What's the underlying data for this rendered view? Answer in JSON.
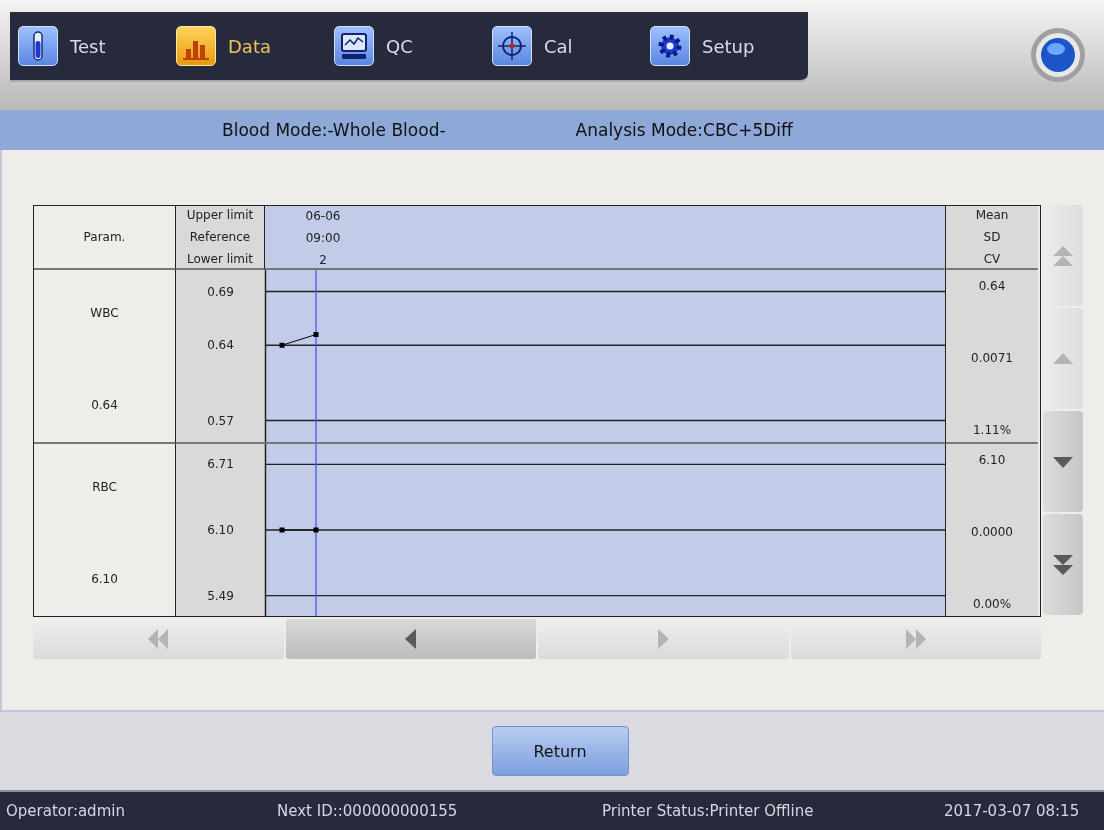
{
  "tabs": [
    {
      "label": "Test",
      "kind": "tube",
      "selected": false
    },
    {
      "label": "Data",
      "kind": "bars",
      "selected": true
    },
    {
      "label": "QC",
      "kind": "monitor",
      "selected": false
    },
    {
      "label": "Cal",
      "kind": "crosshair",
      "selected": false
    },
    {
      "label": "Setup",
      "kind": "gear",
      "selected": false
    }
  ],
  "mode_bar": {
    "blood_mode": "Blood Mode:-Whole Blood-",
    "analysis_mode": "Analysis Mode:CBC+5Diff"
  },
  "table": {
    "param_header": "Param.",
    "limit_headers": [
      "Upper limit",
      "Reference",
      "Lower limit"
    ],
    "point_header": [
      "06-06",
      "09:00",
      "2"
    ],
    "stat_headers": [
      "Mean",
      "SD",
      "CV"
    ],
    "rows": [
      {
        "param": "WBC",
        "value": "0.64",
        "stats": [
          "0.64",
          "0.0071",
          "1.11%"
        ],
        "chart_data": {
          "type": "line",
          "categories": [
            null,
            null,
            null,
            null,
            null,
            null,
            null,
            null,
            null,
            null,
            null,
            null,
            null,
            null,
            null,
            null,
            null,
            null,
            null,
            null
          ],
          "values": [
            0.64,
            0.65,
            null,
            null,
            null,
            null,
            null,
            null,
            null,
            null,
            null,
            null,
            null,
            null,
            null,
            null,
            null,
            null,
            null,
            null
          ],
          "ylim": [
            0.55,
            0.71
          ],
          "grid": true,
          "marker": "square",
          "yticks": [
            {
              "value": 0.69,
              "label": "0.69"
            },
            {
              "value": 0.64,
              "label": "0.64"
            },
            {
              "value": 0.57,
              "label": "0.57"
            }
          ]
        }
      },
      {
        "param": "RBC",
        "value": "6.10",
        "stats": [
          "6.10",
          "0.0000",
          "0.00%"
        ],
        "chart_data": {
          "type": "line",
          "categories": [
            null,
            null,
            null,
            null,
            null,
            null,
            null,
            null,
            null,
            null,
            null,
            null,
            null,
            null,
            null,
            null,
            null,
            null,
            null,
            null
          ],
          "values": [
            6.1,
            6.1,
            null,
            null,
            null,
            null,
            null,
            null,
            null,
            null,
            null,
            null,
            null,
            null,
            null,
            null,
            null,
            null,
            null,
            null
          ],
          "ylim": [
            5.3,
            6.9
          ],
          "grid": true,
          "marker": "square",
          "yticks": [
            {
              "value": 6.71,
              "label": "6.71"
            },
            {
              "value": 6.1,
              "label": "6.10"
            },
            {
              "value": 5.49,
              "label": "5.49"
            }
          ]
        }
      }
    ]
  },
  "scroll_buttons": [
    {
      "kind": "top",
      "disabled": true
    },
    {
      "kind": "up",
      "disabled": true
    },
    {
      "kind": "down",
      "disabled": false
    },
    {
      "kind": "bottom",
      "disabled": false
    }
  ],
  "pager_buttons": [
    {
      "kind": "first",
      "disabled": true
    },
    {
      "kind": "prev",
      "disabled": false
    },
    {
      "kind": "next",
      "disabled": true
    },
    {
      "kind": "last",
      "disabled": true
    }
  ],
  "return_button": "Return",
  "status_bar": {
    "operator": "Operator:admin",
    "next_id": "Next ID::000000000155",
    "printer": "Printer Status:Printer Offline",
    "datetime": "2017-03-07 08:15"
  }
}
